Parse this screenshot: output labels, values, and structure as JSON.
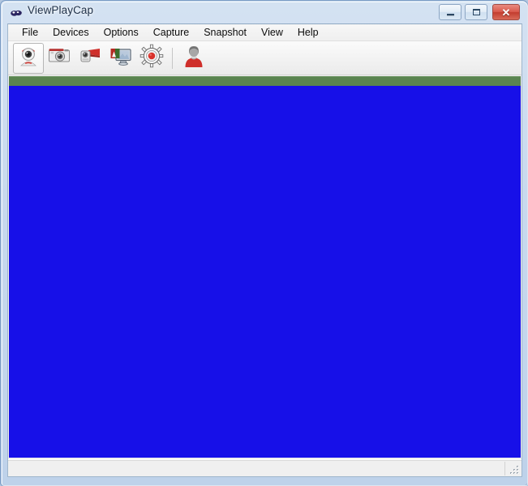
{
  "window": {
    "title": "ViewPlayCap",
    "title_icon": "webcam-eyes-icon",
    "controls": {
      "minimize_label": "–",
      "maximize_label": "□",
      "close_label": "✕",
      "minimize_name": "minimize",
      "maximize_name": "maximize",
      "close_name": "close"
    }
  },
  "menubar": {
    "items": [
      {
        "label": "File",
        "name": "file"
      },
      {
        "label": "Devices",
        "name": "devices"
      },
      {
        "label": "Options",
        "name": "options"
      },
      {
        "label": "Capture",
        "name": "capture"
      },
      {
        "label": "Snapshot",
        "name": "snapshot"
      },
      {
        "label": "View",
        "name": "view"
      },
      {
        "label": "Help",
        "name": "help"
      }
    ]
  },
  "toolbar": {
    "buttons": [
      {
        "name": "webcam-device-icon",
        "label": "Webcam",
        "pressed": true
      },
      {
        "name": "photo-camera-icon",
        "label": "Still Snapshot",
        "pressed": false
      },
      {
        "name": "camcorder-icon",
        "label": "Video Capture",
        "pressed": false
      },
      {
        "name": "display-settings-icon",
        "label": "Display Settings",
        "pressed": false
      },
      {
        "name": "record-gear-icon",
        "label": "Capture Settings",
        "pressed": false
      },
      {
        "name": "user-avatar-icon",
        "label": "User",
        "pressed": false
      }
    ]
  },
  "preview": {
    "name": "video-preview-surface",
    "band_color": "#5a8450",
    "video_color": "#1710e8"
  },
  "statusbar": {
    "text": "",
    "grip_name": "resize-grip"
  },
  "colors": {
    "frame": "#c8d9ee",
    "accent_blue": "#1710e8",
    "band_green": "#5a8450",
    "close_red": "#c23d2f",
    "client_gray": "#f0f0f0"
  }
}
